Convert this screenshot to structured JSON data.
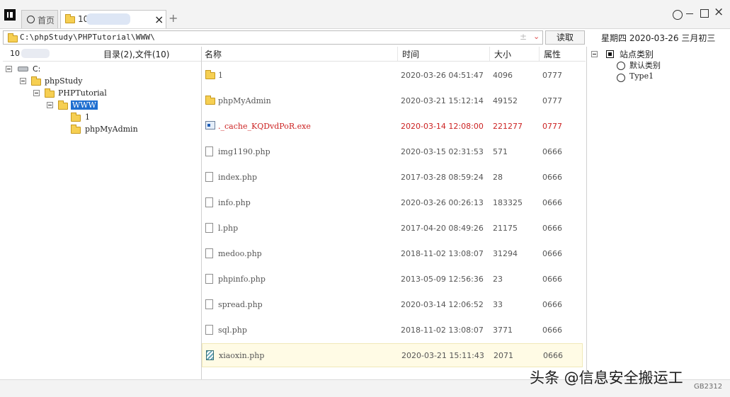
{
  "tabs": {
    "home_label": "首页",
    "active_prefix": "10",
    "close_glyph": "×",
    "add_glyph": "+"
  },
  "window_controls": {
    "circle_icon": "circle-icon",
    "minimize_icon": "minimize-icon",
    "maximize_icon": "maximize-icon",
    "close_glyph": "×"
  },
  "address": {
    "path": "C:\\phpStudy\\PHPTutorial\\WWW\\",
    "extra_glyph": "±",
    "chevron_glyph": "⌄",
    "read_button": "读取"
  },
  "date_info": "星期四 2020-03-26 三月初三",
  "left_panel": {
    "count_prefix": "10",
    "summary": "目录(2),文件(10)",
    "tree": [
      {
        "label": "C:",
        "icon": "drive-icon"
      },
      {
        "label": "phpStudy",
        "icon": "folder-icon"
      },
      {
        "label": "PHPTutorial",
        "icon": "folder-icon"
      },
      {
        "label": "WWW",
        "icon": "folder-icon",
        "selected": true
      },
      {
        "label": "1",
        "icon": "folder-icon"
      },
      {
        "label": "phpMyAdmin",
        "icon": "folder-icon"
      }
    ]
  },
  "file_list": {
    "headers": {
      "name": "名称",
      "time": "时间",
      "size": "大小",
      "attr": "属性"
    },
    "rows": [
      {
        "name": "1",
        "time": "2020-03-26 04:51:47",
        "size": "4096",
        "attr": "0777",
        "icon": "folder-icon"
      },
      {
        "name": "phpMyAdmin",
        "time": "2020-03-21 15:12:14",
        "size": "49152",
        "attr": "0777",
        "icon": "folder-icon"
      },
      {
        "name": "._cache_KQDvdPoR.exe",
        "time": "2020-03-14 12:08:00",
        "size": "221277",
        "attr": "0777",
        "icon": "exe-icon",
        "color": "#cc2222"
      },
      {
        "name": "img1190.php",
        "time": "2020-03-15 02:31:53",
        "size": "571",
        "attr": "0666",
        "icon": "file-icon"
      },
      {
        "name": "index.php",
        "time": "2017-03-28 08:59:24",
        "size": "28",
        "attr": "0666",
        "icon": "file-icon"
      },
      {
        "name": "info.php",
        "time": "2020-03-26 00:26:13",
        "size": "183325",
        "attr": "0666",
        "icon": "file-icon"
      },
      {
        "name": "l.php",
        "time": "2017-04-20 08:49:26",
        "size": "21175",
        "attr": "0666",
        "icon": "file-icon"
      },
      {
        "name": "medoo.php",
        "time": "2018-11-02 13:08:07",
        "size": "31294",
        "attr": "0666",
        "icon": "file-icon"
      },
      {
        "name": "phpinfo.php",
        "time": "2013-05-09 12:56:36",
        "size": "23",
        "attr": "0666",
        "icon": "file-icon"
      },
      {
        "name": "spread.php",
        "time": "2020-03-14 12:06:52",
        "size": "33",
        "attr": "0666",
        "icon": "file-icon"
      },
      {
        "name": "sql.php",
        "time": "2018-11-02 13:08:07",
        "size": "3771",
        "attr": "0666",
        "icon": "file-icon"
      },
      {
        "name": "xiaoxin.php",
        "time": "2020-03-21 15:11:43",
        "size": "2071",
        "attr": "0666",
        "icon": "image-file-icon",
        "highlight": true
      }
    ]
  },
  "category_panel": {
    "root_label": "站点类别",
    "items": [
      "默认类别",
      "Type1"
    ]
  },
  "bottom": {
    "watermark": "头条 @信息安全搬运工",
    "code": "GB2312"
  }
}
